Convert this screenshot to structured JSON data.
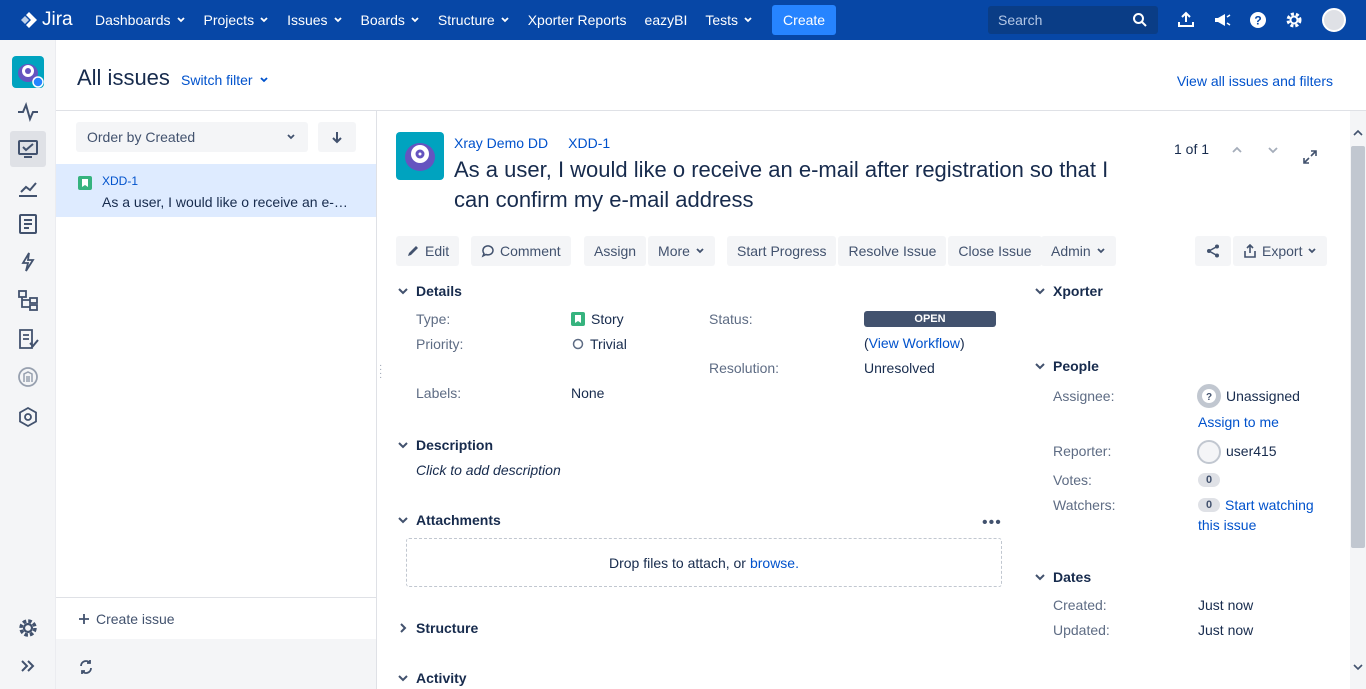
{
  "nav": {
    "logo": "Jira",
    "items": [
      {
        "label": "Dashboards",
        "dropdown": true
      },
      {
        "label": "Projects",
        "dropdown": true
      },
      {
        "label": "Issues",
        "dropdown": true
      },
      {
        "label": "Boards",
        "dropdown": true
      },
      {
        "label": "Structure",
        "dropdown": true
      },
      {
        "label": "Xporter Reports",
        "dropdown": false
      },
      {
        "label": "eazyBI",
        "dropdown": false
      },
      {
        "label": "Tests",
        "dropdown": true
      }
    ],
    "create": "Create",
    "search_placeholder": "Search"
  },
  "header": {
    "title": "All issues",
    "switch_filter": "Switch filter",
    "view_all": "View all issues and filters"
  },
  "list": {
    "order": "Order by Created",
    "items": [
      {
        "key": "XDD-1",
        "summary": "As a user, I would like o receive an e-mail after registration so that I can confirm my e-mail address"
      }
    ],
    "create_issue": "Create issue"
  },
  "issue": {
    "project": "Xray Demo DD",
    "key": "XDD-1",
    "summary": "As a user, I would like o receive an e-mail after registration so that I can confirm my e-mail address",
    "pager": "1 of 1",
    "toolbar": {
      "edit": "Edit",
      "comment": "Comment",
      "assign": "Assign",
      "more": "More",
      "start_progress": "Start Progress",
      "resolve": "Resolve Issue",
      "close": "Close Issue",
      "admin": "Admin",
      "export": "Export"
    },
    "details": {
      "title": "Details",
      "type_label": "Type:",
      "type": "Story",
      "priority_label": "Priority:",
      "priority": "Trivial",
      "labels_label": "Labels:",
      "labels": "None",
      "status_label": "Status:",
      "status": "OPEN",
      "view_workflow": "View Workflow",
      "resolution_label": "Resolution:",
      "resolution": "Unresolved"
    },
    "description": {
      "title": "Description",
      "placeholder": "Click to add description"
    },
    "attachments": {
      "title": "Attachments",
      "drop_text": "Drop files to attach, or",
      "browse": "browse."
    },
    "structure": {
      "title": "Structure"
    },
    "activity": {
      "title": "Activity"
    },
    "xporter": {
      "title": "Xporter"
    },
    "people": {
      "title": "People",
      "assignee_label": "Assignee:",
      "assignee": "Unassigned",
      "assign_to_me": "Assign to me",
      "reporter_label": "Reporter:",
      "reporter": "user415",
      "votes_label": "Votes:",
      "votes": "0",
      "watchers_label": "Watchers:",
      "watchers": "0",
      "start_watching_1": "Start watching",
      "start_watching_2": "this issue"
    },
    "dates": {
      "title": "Dates",
      "created_label": "Created:",
      "created": "Just now",
      "updated_label": "Updated:",
      "updated": "Just now"
    }
  },
  "colors": {
    "nav": "#0747a6",
    "create": "#2684ff",
    "link": "#0052cc",
    "story": "#36b37e",
    "status": "#42526e"
  }
}
